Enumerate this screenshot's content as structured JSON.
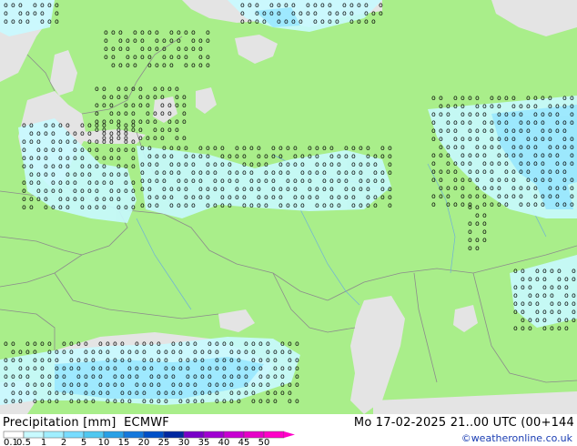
{
  "header": {
    "product": "Precipitation [mm]",
    "model": "ECMWF",
    "datetime": "Mo 17-02-2025 21..00 UTC (00+144",
    "copyright": "©weatheronline.co.uk"
  },
  "legend": {
    "labels": [
      "0.1",
      "0.5",
      "1",
      "2",
      "5",
      "10",
      "15",
      "20",
      "25",
      "30",
      "35",
      "40",
      "45",
      "50"
    ],
    "colors": [
      "#ffffff",
      "#c8faff",
      "#a0eeff",
      "#78dcff",
      "#50c8f0",
      "#28a0e6",
      "#1478dc",
      "#0050c8",
      "#0028a0",
      "#7800c8",
      "#a000d2",
      "#c800d2",
      "#e600c8",
      "#ff00c8"
    ]
  },
  "map": {
    "land_color": "#a9ee8a",
    "sea_color": "#e4e4e4",
    "precip_light": "#c8faff",
    "precip_medium": "#96e6ff",
    "border_color": "#8c8c8c"
  }
}
